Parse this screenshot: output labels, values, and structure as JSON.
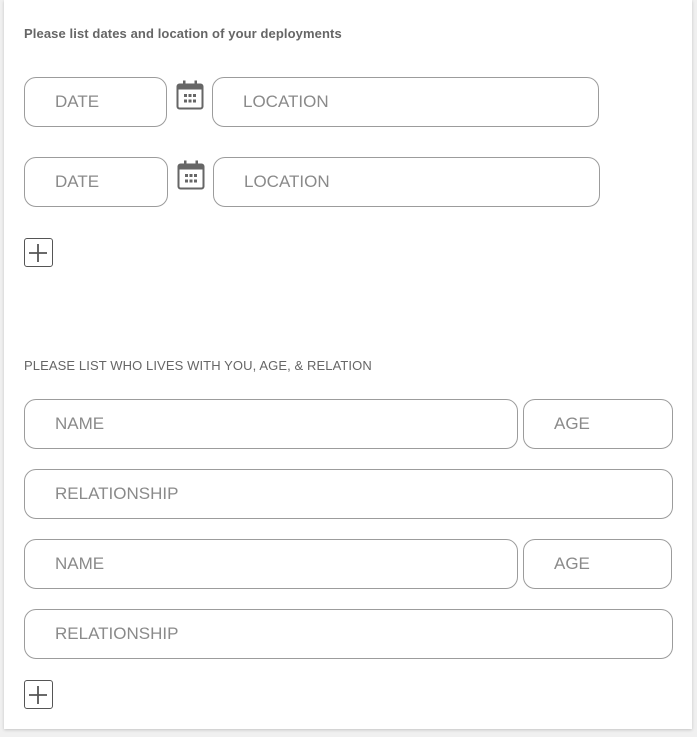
{
  "deployments": {
    "heading": "Please list dates and location of your deployments",
    "rows": [
      {
        "date_placeholder": "DATE",
        "location_placeholder": "LOCATION"
      },
      {
        "date_placeholder": "DATE",
        "location_placeholder": "LOCATION"
      }
    ],
    "add_icon": "plus-icon",
    "calendar_icon": "calendar-icon"
  },
  "household": {
    "heading": "PLEASE LIST WHO LIVES WITH YOU, AGE, & RELATION",
    "members": [
      {
        "name_placeholder": "NAME",
        "age_placeholder": "AGE",
        "relationship_placeholder": "RELATIONSHIP"
      },
      {
        "name_placeholder": "NAME",
        "age_placeholder": "AGE",
        "relationship_placeholder": "RELATIONSHIP"
      }
    ],
    "add_icon": "plus-icon"
  },
  "colors": {
    "border": "#9c9c9c",
    "placeholder": "#8a8a8a",
    "label": "#666666",
    "icon": "#666666"
  }
}
